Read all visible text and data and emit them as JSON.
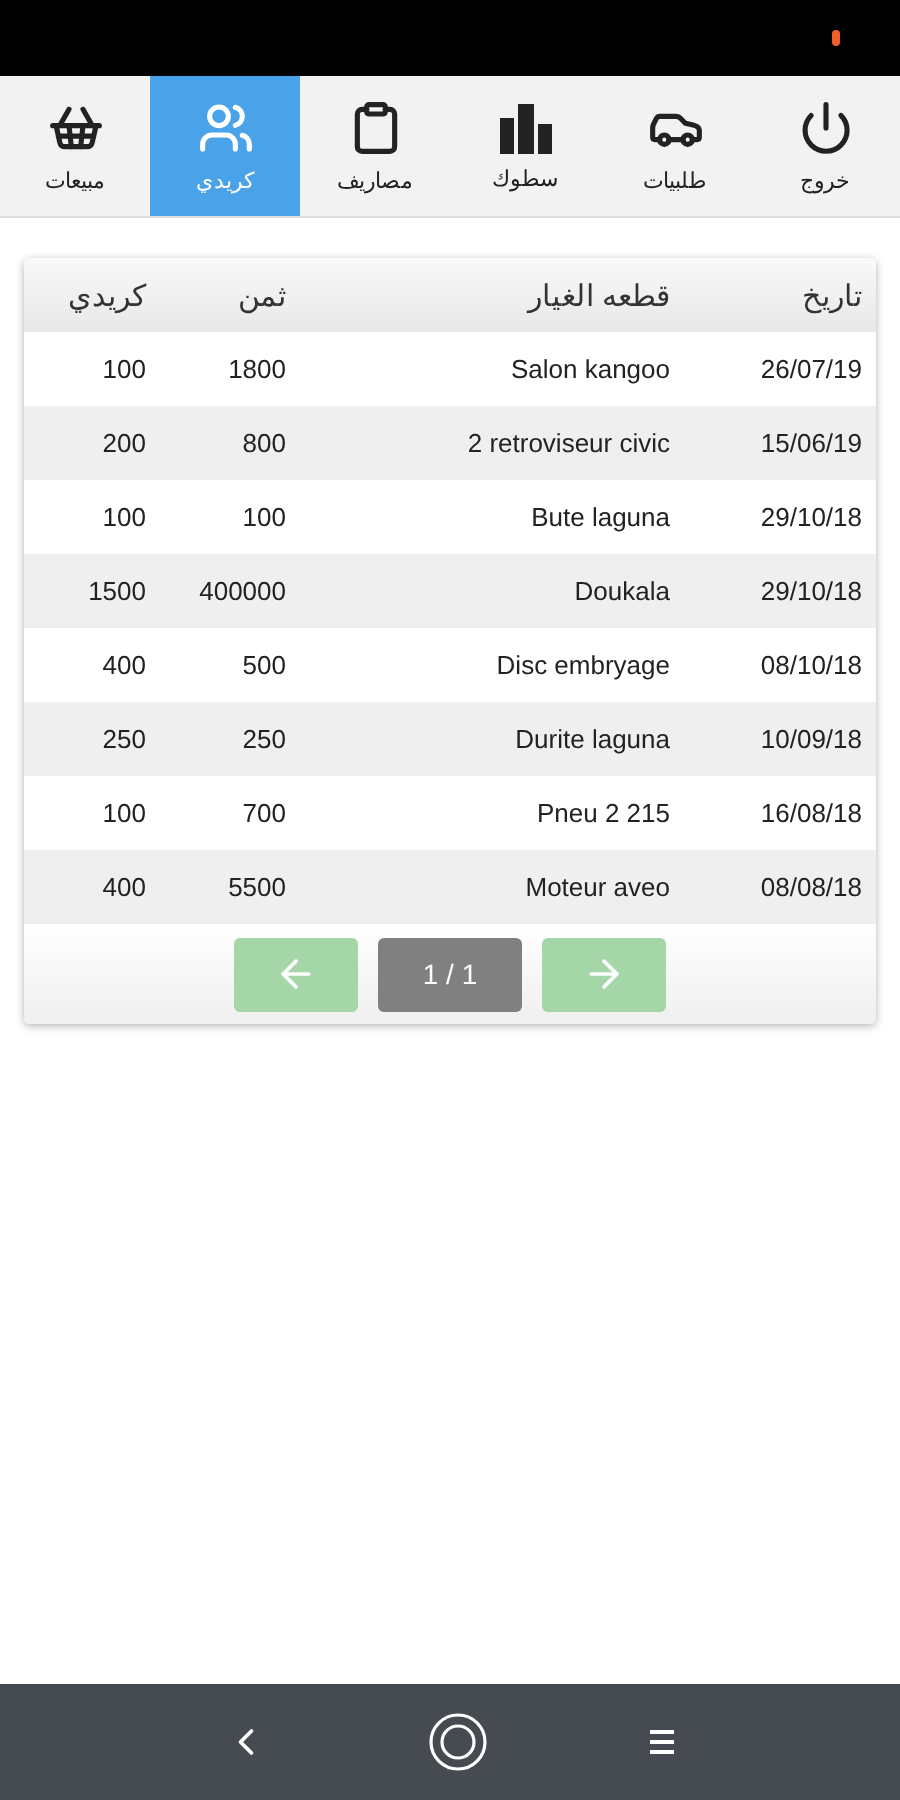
{
  "tabs": [
    {
      "label": "خروج",
      "selected": false
    },
    {
      "label": "طلبيات",
      "selected": false
    },
    {
      "label": "سطوك",
      "selected": false
    },
    {
      "label": "مصاريف",
      "selected": false
    },
    {
      "label": "كريدي",
      "selected": true
    },
    {
      "label": "مبيعات",
      "selected": false
    }
  ],
  "table": {
    "columns": [
      "كريدي",
      "ثمن",
      "قطعه الغيار",
      "تاريخ"
    ],
    "rows": [
      [
        "100",
        "1800",
        "Salon kangoo",
        "26/07/19"
      ],
      [
        "200",
        "800",
        "2 retroviseur civic",
        "15/06/19"
      ],
      [
        "100",
        "100",
        "Bute laguna",
        "29/10/18"
      ],
      [
        "1500",
        "400000",
        "Doukala",
        "29/10/18"
      ],
      [
        "400",
        "500",
        "Disc embryage",
        "08/10/18"
      ],
      [
        "250",
        "250",
        "Durite laguna",
        "10/09/18"
      ],
      [
        "100",
        "700",
        "Pneu 2 215",
        "16/08/18"
      ],
      [
        "400",
        "5500",
        "Moteur aveo",
        "08/08/18"
      ]
    ]
  },
  "pagination": {
    "previous_disabled": true,
    "page": "1 / 1",
    "next_disabled": true
  }
}
